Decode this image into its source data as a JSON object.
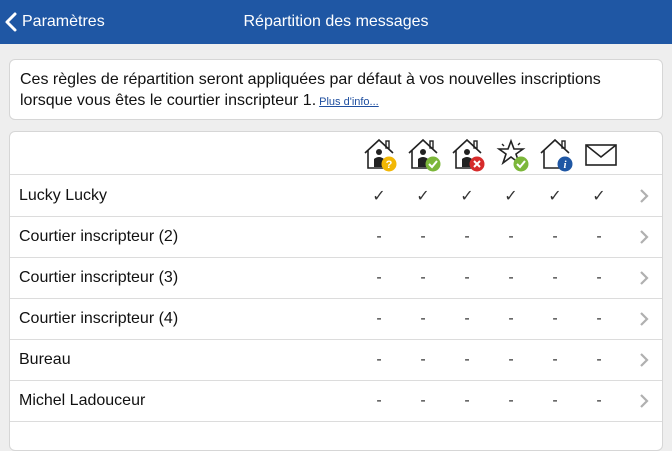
{
  "header": {
    "back_label": "Paramètres",
    "title": "Répartition des messages"
  },
  "info": {
    "text": "Ces règles de répartition seront appliquées par défaut à vos nouvelles inscriptions lorsque vous êtes le courtier inscripteur 1.",
    "link": "Plus d'info..."
  },
  "columns": [
    {
      "icon": "house-person-question-icon",
      "badge_color": "#f2b705"
    },
    {
      "icon": "house-person-check-icon",
      "badge_color": "#7cb73a"
    },
    {
      "icon": "house-person-cross-icon",
      "badge_color": "#d62b2b"
    },
    {
      "icon": "star-check-icon",
      "badge_color": "#7cb73a"
    },
    {
      "icon": "house-info-icon",
      "badge_color": "#1f57a4"
    },
    {
      "icon": "envelope-icon",
      "badge_color": ""
    }
  ],
  "rows": [
    {
      "name": "Lucky Lucky",
      "values": [
        "✓",
        "✓",
        "✓",
        "✓",
        "✓",
        "✓"
      ]
    },
    {
      "name": "Courtier inscripteur (2)",
      "values": [
        "-",
        "-",
        "-",
        "-",
        "-",
        "-"
      ]
    },
    {
      "name": "Courtier inscripteur (3)",
      "values": [
        "-",
        "-",
        "-",
        "-",
        "-",
        "-"
      ]
    },
    {
      "name": "Courtier inscripteur (4)",
      "values": [
        "-",
        "-",
        "-",
        "-",
        "-",
        "-"
      ]
    },
    {
      "name": "Bureau",
      "values": [
        "-",
        "-",
        "-",
        "-",
        "-",
        "-"
      ]
    },
    {
      "name": "Michel Ladouceur",
      "values": [
        "-",
        "-",
        "-",
        "-",
        "-",
        "-"
      ]
    }
  ],
  "colors": {
    "topbar": "#1f57a4",
    "link": "#1f4fa0"
  }
}
